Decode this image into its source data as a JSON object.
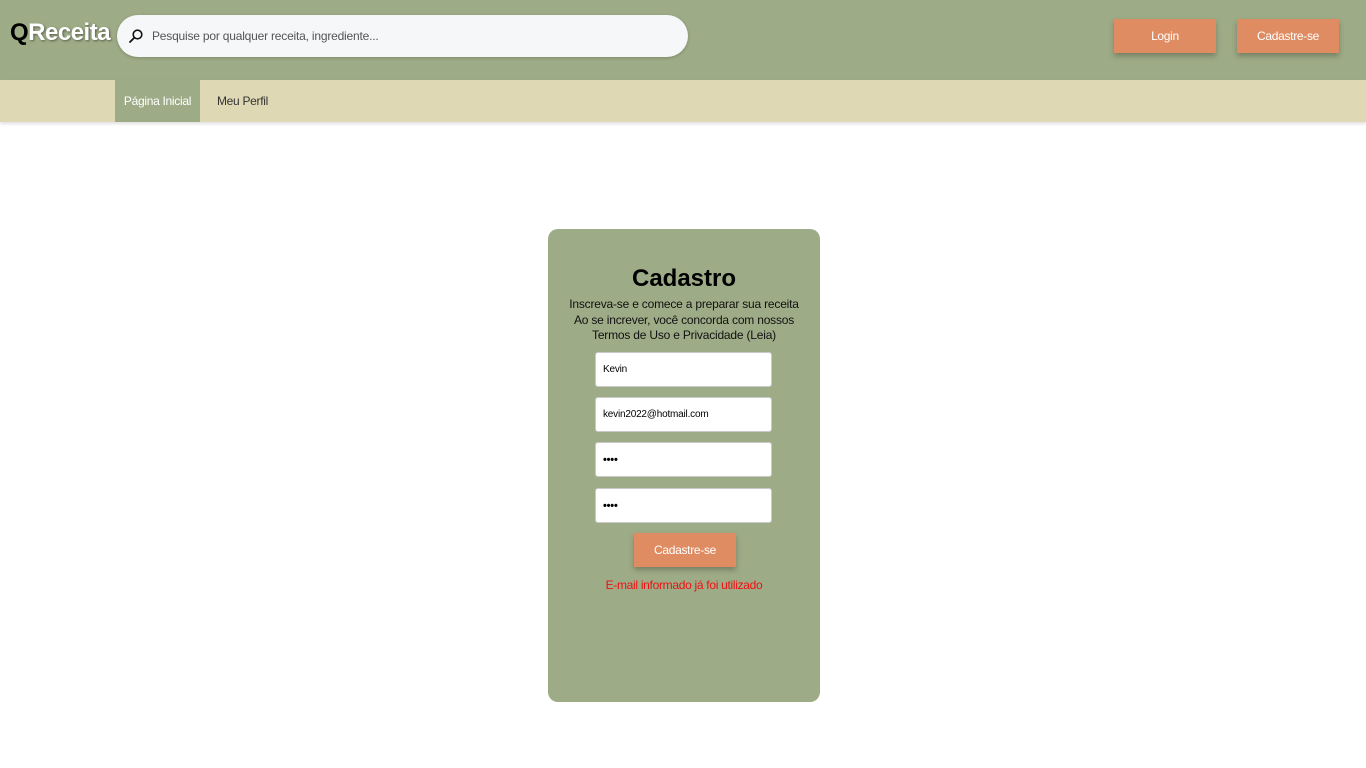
{
  "header": {
    "logo_q": "Q",
    "logo_rest": "Receita",
    "search_placeholder": "Pesquise por qualquer receita, ingrediente...",
    "login_label": "Login",
    "signup_label": "Cadastre-se"
  },
  "nav": {
    "items": [
      {
        "label": "Página Inicial",
        "active": true
      },
      {
        "label": "Meu Perfil",
        "active": false
      }
    ]
  },
  "form": {
    "title": "Cadastro",
    "subtitle_lines": [
      "Inscreva-se e comece  a preparar sua receita",
      "Ao se increver, você concorda com nossos",
      "Termos de Uso e Privacidade (Leia)"
    ],
    "fields": {
      "name_value": "Kevin",
      "email_value": "kevin2022@hotmail.com",
      "password_value": "••••",
      "confirm_password_value": "••••"
    },
    "submit_label": "Cadastre-se",
    "error_message": "E-mail informado já foi utilizado"
  },
  "colors": {
    "header_bg": "#9dab86",
    "nav_bg": "#dfd8b5",
    "accent_orange": "#e08c62",
    "card_bg": "#9dab86",
    "error": "#ee1111"
  },
  "icons": {
    "search": "search-icon"
  }
}
